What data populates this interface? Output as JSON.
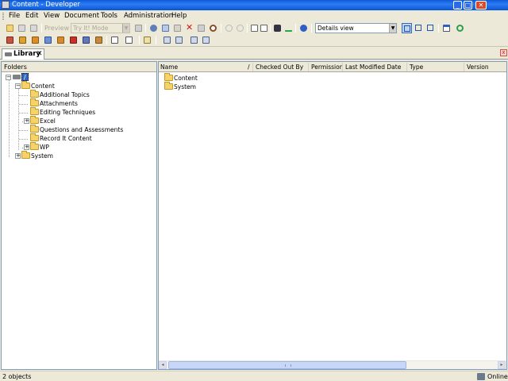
{
  "window": {
    "title": "Content - Developer",
    "min_glyph": "_",
    "max_glyph": "□",
    "close_glyph": "✕"
  },
  "menubar": {
    "items": [
      "File",
      "Edit",
      "View",
      "Document",
      "Tools",
      "Administration",
      "Help"
    ]
  },
  "toolbar": {
    "preview_label": "Preview",
    "mode_combo": "Try It! Mode",
    "view_combo": "Details view",
    "combo_arrow": "▼"
  },
  "tabs": {
    "library": {
      "label": "Library",
      "close_glyph": "✕"
    },
    "strip_close_glyph": "x"
  },
  "folders_pane": {
    "header": "Folders",
    "root": {
      "label": "/",
      "expander": "−"
    },
    "content": {
      "label": "Content",
      "expander": "−"
    },
    "children": [
      {
        "label": "Additional Topics",
        "expander": ""
      },
      {
        "label": "Attachments",
        "expander": ""
      },
      {
        "label": "Editing Techniques",
        "expander": ""
      },
      {
        "label": "Excel",
        "expander": "+"
      },
      {
        "label": "Questions and Assessments",
        "expander": ""
      },
      {
        "label": "Record It Content",
        "expander": ""
      },
      {
        "label": "WP",
        "expander": "+"
      }
    ],
    "system": {
      "label": "System",
      "expander": "+"
    }
  },
  "files_pane": {
    "columns": {
      "name": "Name",
      "sort_indicator": "/",
      "checked_out_by": "Checked Out By",
      "permission": "Permission",
      "last_modified": "Last Modified Date",
      "type": "Type",
      "version": "Version"
    },
    "rows": [
      {
        "name": "Content"
      },
      {
        "name": "System"
      }
    ],
    "scroll_left_glyph": "◂",
    "scroll_right_glyph": "▸"
  },
  "statusbar": {
    "left": "2 objects",
    "right": "Online"
  },
  "icons": [
    "new-icon",
    "open-icon",
    "save-icon",
    "print-icon",
    "publish-icon",
    "cut-icon",
    "copy-icon",
    "paste-icon",
    "delete-icon",
    "properties-icon",
    "find-icon",
    "undo-icon",
    "redo-icon",
    "zoom-in-icon",
    "zoom-out-icon",
    "binoculars-icon",
    "spell-check-icon",
    "help-icon",
    "details-view-icon",
    "list-view-icon",
    "split-view-icon",
    "window-icon",
    "refresh-icon"
  ]
}
